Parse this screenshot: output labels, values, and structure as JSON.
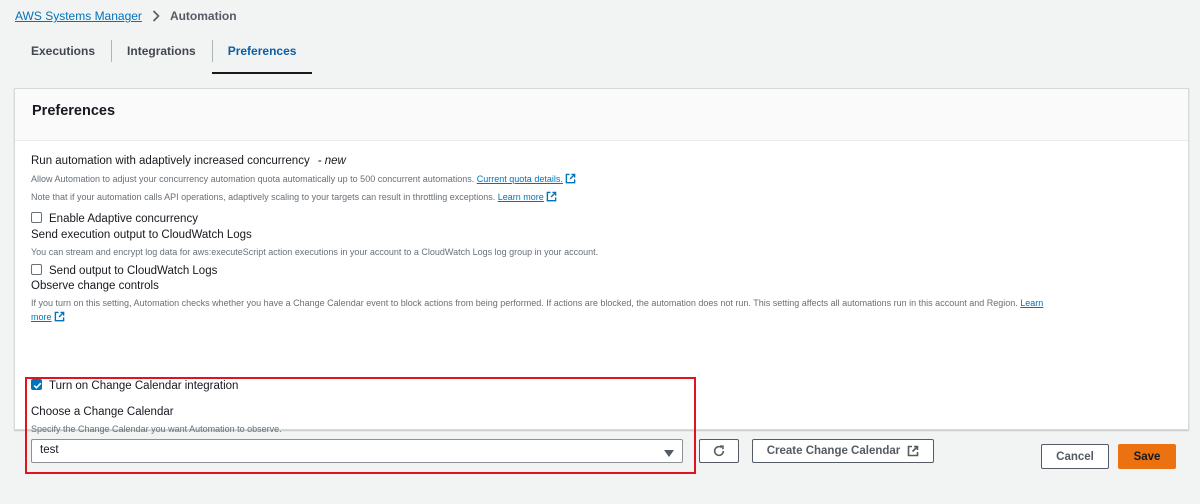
{
  "breadcrumb": {
    "root": "AWS Systems Manager",
    "current": "Automation"
  },
  "tabs": [
    {
      "label": "Executions",
      "active": false
    },
    {
      "label": "Integrations",
      "active": false
    },
    {
      "label": "Preferences",
      "active": true
    }
  ],
  "panel": {
    "title": "Preferences",
    "concurrency": {
      "label": "Run automation with adaptively increased concurrency",
      "new_tag": "- new",
      "desc1": "Allow Automation to adjust your concurrency automation quota automatically up to 500 concurrent automations.",
      "desc1_link": "Current quota details.",
      "desc2": "Note that if your automation calls API operations, adaptively scaling to your targets can result in throttling exceptions.",
      "desc2_link": "Learn more",
      "checkbox_label": "Enable Adaptive concurrency",
      "checked": false
    },
    "cloudwatch": {
      "label": "Send execution output to CloudWatch Logs",
      "desc": "You can stream and encrypt log data for aws:executeScript action executions in your account to a CloudWatch Logs log group in your account.",
      "checkbox_label": "Send output to CloudWatch Logs",
      "checked": false
    },
    "change_controls": {
      "label": "Observe change controls",
      "desc": "If you turn on this setting, Automation checks whether you have a Change Calendar event to block actions from being performed. If actions are blocked, the automation does not run. This setting affects all automations run in this account and Region.",
      "link_part1": "Learn",
      "link_part2": "more",
      "checkbox_label": "Turn on Change Calendar integration",
      "checked": true,
      "calendar_label": "Choose a Change Calendar",
      "calendar_desc": "Specify the Change Calendar you want Automation to observe.",
      "calendar_value": "test",
      "create_button": "Create Change Calendar"
    }
  },
  "footer": {
    "cancel": "Cancel",
    "save": "Save"
  },
  "colors": {
    "link": "#0073bb",
    "primary_button": "#ec7211",
    "highlight_box": "#e0141e"
  },
  "icons": {
    "breadcrumb_separator": "chevron-right-icon",
    "external_link": "external-link-icon",
    "refresh": "refresh-icon",
    "dropdown": "caret-down-icon",
    "checkbox_checked": "checkmark-icon"
  }
}
